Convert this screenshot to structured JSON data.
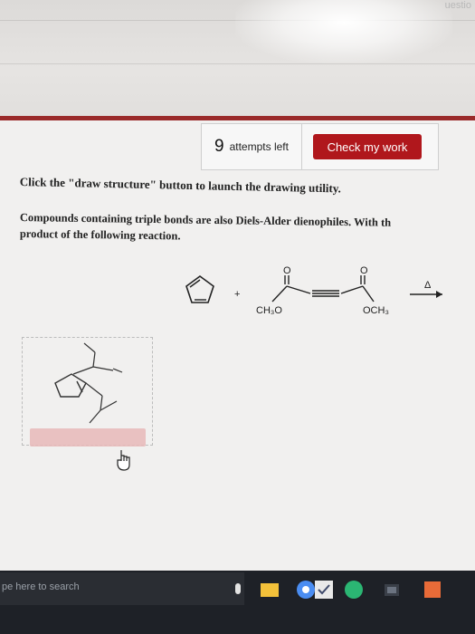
{
  "corner": {
    "label": "uestio"
  },
  "attempts": {
    "count": "9",
    "label": "attempts left"
  },
  "toolbar": {
    "check_label": "Check my work"
  },
  "instruction": "Click the \"draw structure\" button to launch the drawing utility.",
  "question": {
    "line1": "Compounds containing triple bonds are also Diels-Alder dienophiles. With th",
    "line2": "product of the following reaction."
  },
  "reaction": {
    "plus": "+",
    "left_carbonyl_o": "O",
    "left_group": "CH₃O",
    "right_carbonyl_o": "O",
    "right_group": "OCH₃",
    "heat_symbol": "Δ"
  },
  "taskbar": {
    "search_placeholder": "pe here to search"
  },
  "colors": {
    "accent": "#b0171c",
    "header_rule": "#9a2a2a",
    "taskbar": "#1e2127"
  },
  "icons": [
    "search-icon",
    "file-explorer-icon",
    "chrome-icon",
    "check-app-icon",
    "green-app-icon",
    "store-icon",
    "office-icon"
  ]
}
